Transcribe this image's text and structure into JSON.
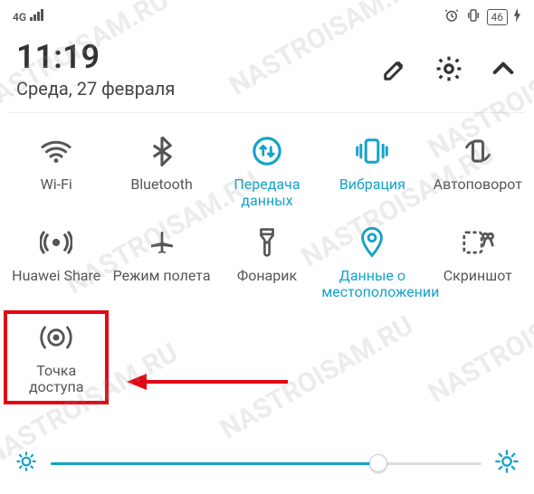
{
  "status": {
    "network": "4G",
    "battery": "46",
    "charging": true
  },
  "header": {
    "time": "11:19",
    "date": "Среда, 27 февраля"
  },
  "tiles": [
    {
      "name": "wifi",
      "label": "Wi-Fi",
      "active": false
    },
    {
      "name": "bluetooth",
      "label": "Bluetooth",
      "active": false
    },
    {
      "name": "data",
      "label": "Передача данных",
      "active": true
    },
    {
      "name": "vibration",
      "label": "Вибрация",
      "active": true
    },
    {
      "name": "autorotate",
      "label": "Автоповорот",
      "active": false
    },
    {
      "name": "huawei-share",
      "label": "Huawei Share",
      "active": false
    },
    {
      "name": "airplane",
      "label": "Режим полета",
      "active": false
    },
    {
      "name": "flashlight",
      "label": "Фонарик",
      "active": false
    },
    {
      "name": "location",
      "label": "Данные о местоположении",
      "active": true
    },
    {
      "name": "screenshot",
      "label": "Скриншот",
      "active": false
    },
    {
      "name": "hotspot",
      "label": "Точка доступа",
      "active": false,
      "highlighted": true
    }
  ],
  "brightness": {
    "percent": 76
  },
  "colors": {
    "accent": "#13a3c7",
    "inactive": "#555",
    "highlight": "#e30613"
  },
  "watermark": "NASTROISAM.RU"
}
